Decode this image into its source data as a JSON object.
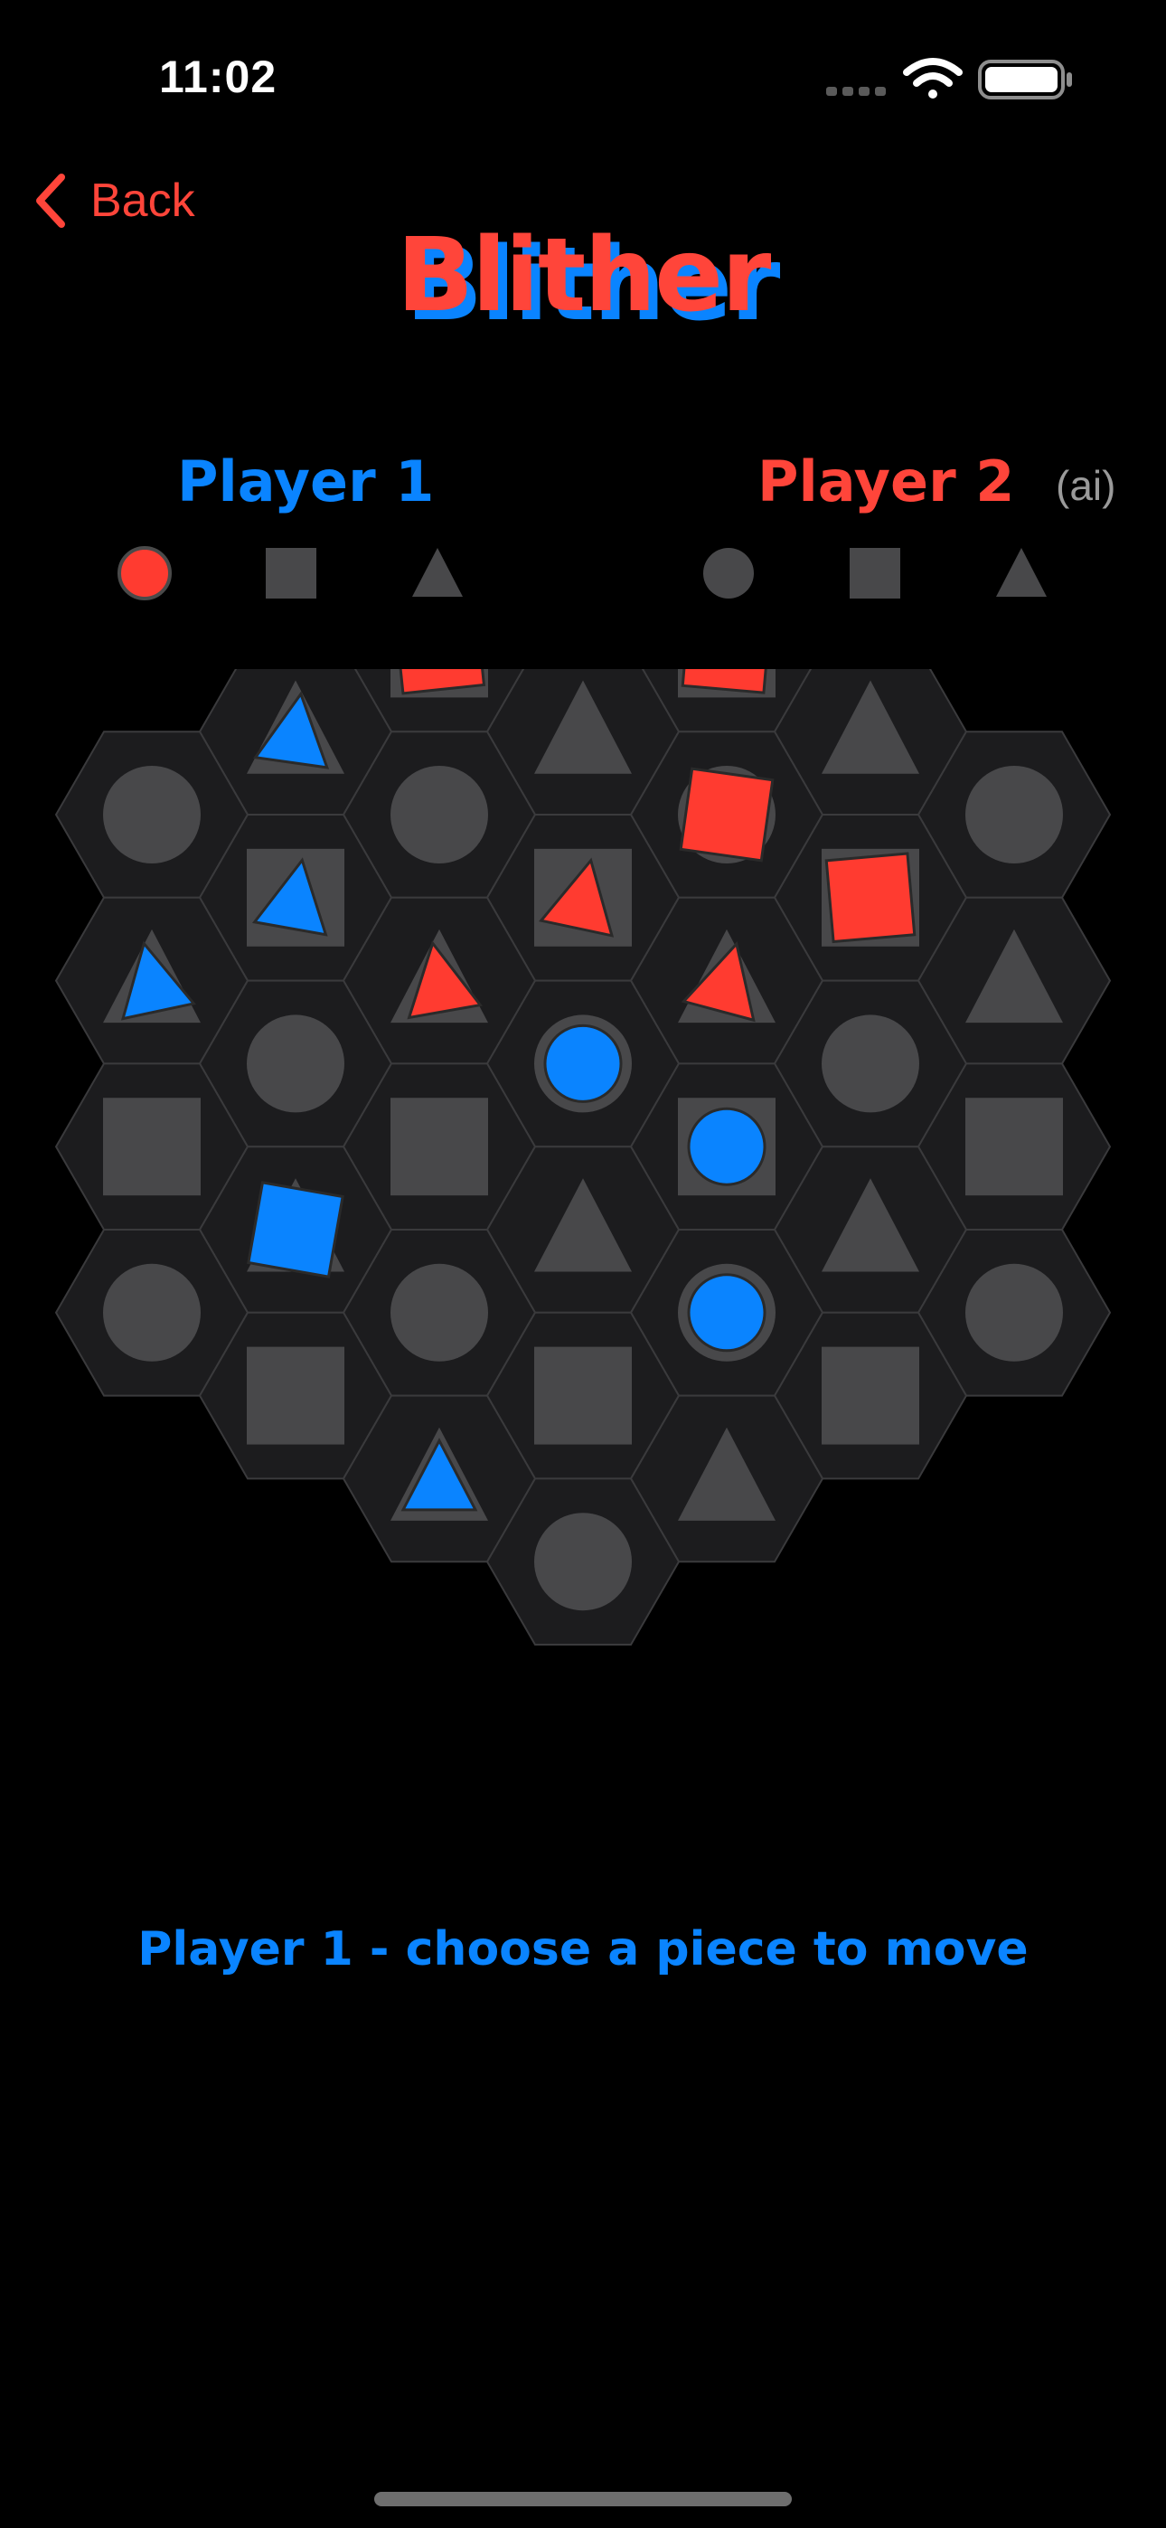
{
  "status_bar": {
    "time": "11:02",
    "cellular": "cellular-signal-icon",
    "wifi": "wifi-icon",
    "battery": "battery-icon"
  },
  "nav": {
    "back_label": "Back",
    "back_icon": "chevron-left-icon"
  },
  "title": "Blither",
  "players": {
    "p1_label": "Player 1",
    "p2_label": "Player 2",
    "p2_tag": "(ai)"
  },
  "selector_shapes": {
    "p1": [
      {
        "shape": "circle",
        "active": true
      },
      {
        "shape": "square",
        "active": false
      },
      {
        "shape": "triangle",
        "active": false
      }
    ],
    "p2": [
      {
        "shape": "circle",
        "active": false
      },
      {
        "shape": "square",
        "active": false
      },
      {
        "shape": "triangle",
        "active": false
      }
    ]
  },
  "board": {
    "cells": [
      {
        "q": 0,
        "r": -4,
        "shape": "circle"
      },
      {
        "q": -1,
        "r": -3,
        "shape": "square",
        "piece": {
          "player": "red",
          "shape": "square",
          "rot": -6
        }
      },
      {
        "q": 1,
        "r": -4,
        "shape": "square",
        "piece": {
          "player": "red",
          "shape": "square",
          "rot": 5
        }
      },
      {
        "q": -2,
        "r": -2,
        "shape": "triangle",
        "piece": {
          "player": "blue",
          "shape": "triangle",
          "rot": 8
        }
      },
      {
        "q": 0,
        "r": -3,
        "shape": "triangle"
      },
      {
        "q": 2,
        "r": -4,
        "shape": "triangle"
      },
      {
        "q": -3,
        "r": -1,
        "shape": "circle"
      },
      {
        "q": -1,
        "r": -2,
        "shape": "circle"
      },
      {
        "q": 1,
        "r": -3,
        "shape": "circle",
        "piece": {
          "player": "red",
          "shape": "square",
          "rot": 8
        }
      },
      {
        "q": 3,
        "r": -4,
        "shape": "circle"
      },
      {
        "q": -2,
        "r": -1,
        "shape": "square",
        "piece": {
          "player": "blue",
          "shape": "triangle",
          "rot": 10
        }
      },
      {
        "q": 0,
        "r": -2,
        "shape": "square",
        "piece": {
          "player": "red",
          "shape": "triangle",
          "rot": 12
        }
      },
      {
        "q": 2,
        "r": -3,
        "shape": "square",
        "piece": {
          "player": "red",
          "shape": "square",
          "rot": -5
        }
      },
      {
        "q": -3,
        "r": 0,
        "shape": "triangle",
        "piece": {
          "player": "blue",
          "shape": "triangle",
          "rot": -12
        }
      },
      {
        "q": -1,
        "r": -1,
        "shape": "triangle",
        "piece": {
          "player": "red",
          "shape": "triangle",
          "rot": -10
        }
      },
      {
        "q": 1,
        "r": -2,
        "shape": "triangle",
        "piece": {
          "player": "red",
          "shape": "triangle",
          "rot": 15
        }
      },
      {
        "q": 3,
        "r": -3,
        "shape": "triangle"
      },
      {
        "q": -2,
        "r": 0,
        "shape": "circle"
      },
      {
        "q": 0,
        "r": -1,
        "shape": "circle",
        "piece": {
          "player": "blue",
          "shape": "circle",
          "rot": 0
        }
      },
      {
        "q": 2,
        "r": -2,
        "shape": "circle"
      },
      {
        "q": -3,
        "r": 1,
        "shape": "square"
      },
      {
        "q": -1,
        "r": 0,
        "shape": "square"
      },
      {
        "q": 1,
        "r": -1,
        "shape": "square",
        "piece": {
          "player": "blue",
          "shape": "circle",
          "rot": 0
        }
      },
      {
        "q": 3,
        "r": -2,
        "shape": "square"
      },
      {
        "q": -2,
        "r": 1,
        "shape": "triangle",
        "piece": {
          "player": "blue",
          "shape": "square",
          "rot": 10
        }
      },
      {
        "q": 0,
        "r": 0,
        "shape": "triangle"
      },
      {
        "q": 2,
        "r": -1,
        "shape": "triangle"
      },
      {
        "q": -3,
        "r": 2,
        "shape": "circle"
      },
      {
        "q": -1,
        "r": 1,
        "shape": "circle"
      },
      {
        "q": 1,
        "r": 0,
        "shape": "circle",
        "piece": {
          "player": "blue",
          "shape": "circle",
          "rot": 0
        }
      },
      {
        "q": 3,
        "r": -1,
        "shape": "circle"
      },
      {
        "q": -2,
        "r": 2,
        "shape": "square"
      },
      {
        "q": 0,
        "r": 1,
        "shape": "square"
      },
      {
        "q": 2,
        "r": 0,
        "shape": "square"
      },
      {
        "q": -1,
        "r": 2,
        "shape": "triangle",
        "piece": {
          "player": "blue",
          "shape": "triangle",
          "rot": 0
        }
      },
      {
        "q": 1,
        "r": 1,
        "shape": "triangle"
      },
      {
        "q": 0,
        "r": 2,
        "shape": "circle"
      }
    ]
  },
  "colors": {
    "blue": "#0a84ff",
    "red": "#ff3b30",
    "tile": "#1c1c1e",
    "tile_border": "#3a3a3c",
    "marker": "#48484a",
    "selector_inactive": "#48484a"
  },
  "message": "Player 1 -  choose a piece to move"
}
